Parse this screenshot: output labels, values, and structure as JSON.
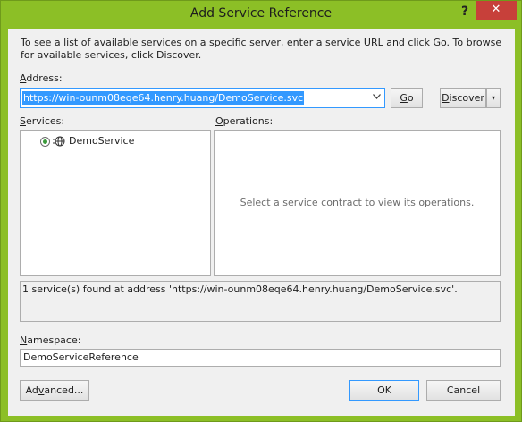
{
  "window": {
    "title": "Add Service Reference",
    "help_glyph": "?",
    "close_glyph": "✕",
    "accent_color": "#8cbf26",
    "close_color": "#c7403a"
  },
  "intro": {
    "text": "To see a list of available services on a specific server, enter a service URL and click Go. To browse for available services, click Discover."
  },
  "address": {
    "label_mnemonic": "A",
    "label_rest": "ddress:",
    "value": "https://win-ounm08eqe64.henry.huang/DemoService.svc",
    "dropdown_icon": "chevron-down-icon"
  },
  "buttons": {
    "go_mnemonic": "G",
    "go_rest": "o",
    "discover_mnemonic": "D",
    "discover_rest": "iscover",
    "discover_arrow": "▾",
    "advanced_prefix": "Ad",
    "advanced_mnemonic": "v",
    "advanced_rest": "anced...",
    "ok": "OK",
    "cancel": "Cancel"
  },
  "services": {
    "label_mnemonic": "S",
    "label_rest": "ervices:",
    "items": [
      {
        "label": "DemoService",
        "icon": "service-globe-icon",
        "selected": true
      }
    ]
  },
  "operations": {
    "label_mnemonic": "O",
    "label_rest": "perations:",
    "placeholder": "Select a service contract to view its operations."
  },
  "status": {
    "text": "1 service(s) found at address 'https://win-ounm08eqe64.henry.huang/DemoService.svc'."
  },
  "namespace": {
    "label_mnemonic": "N",
    "label_rest": "amespace:",
    "value": "DemoServiceReference"
  }
}
